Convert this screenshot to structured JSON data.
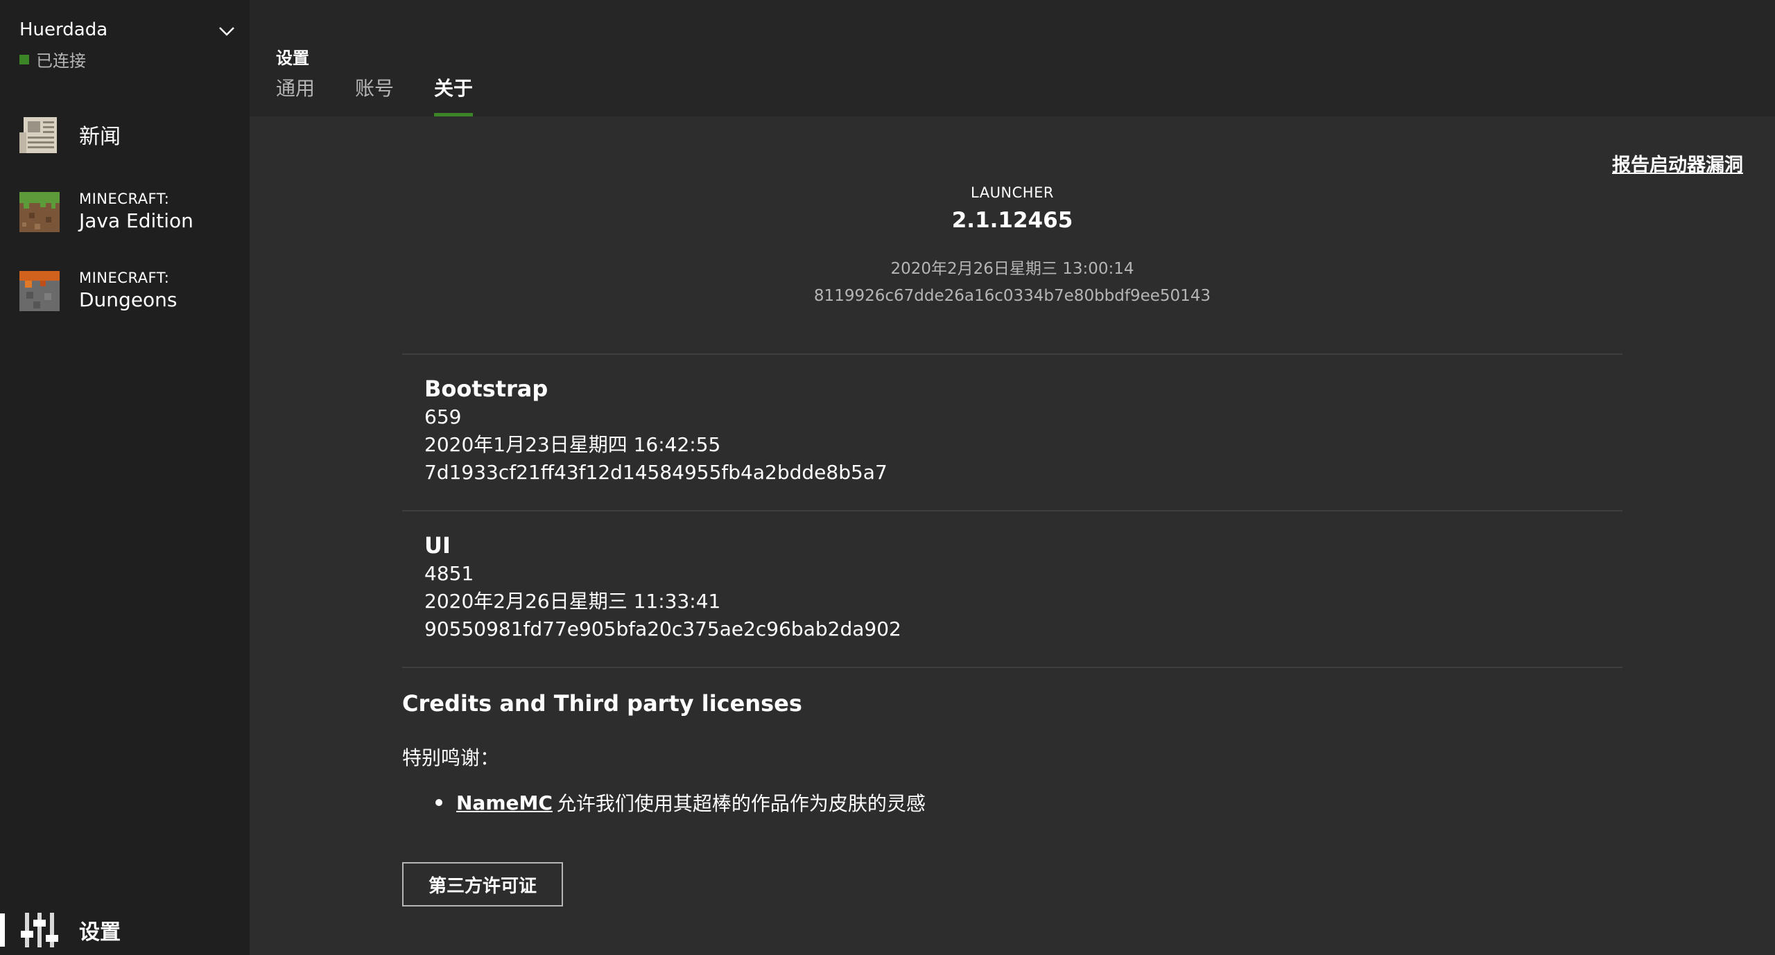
{
  "account": {
    "name": "Huerdada",
    "status": "已连接",
    "status_color": "#3c8527"
  },
  "sidebar": {
    "news": {
      "label": "新闻",
      "icon": "newspaper-icon"
    },
    "java": {
      "label_small": "MINECRAFT:",
      "label": "Java Edition",
      "icon": "grass-block-icon"
    },
    "dungeons": {
      "label_small": "MINECRAFT:",
      "label": "Dungeons",
      "icon": "dungeons-block-icon"
    },
    "settings": {
      "label": "设置",
      "icon": "sliders-icon"
    }
  },
  "header": {
    "title": "设置",
    "tabs": [
      {
        "label": "通用",
        "active": false
      },
      {
        "label": "账号",
        "active": false
      },
      {
        "label": "关于",
        "active": true
      }
    ],
    "accent": "#3c8527"
  },
  "main": {
    "report_link": "报告启动器漏洞",
    "launcher": {
      "label": "LAUNCHER",
      "version": "2.1.12465",
      "date": "2020年2月26日星期三 13:00:14",
      "hash": "8119926c67dde26a16c0334b7e80bbdf9ee50143"
    },
    "bootstrap": {
      "name": "Bootstrap",
      "build": "659",
      "date": "2020年1月23日星期四 16:42:55",
      "hash": "7d1933cf21ff43f12d14584955fb4a2bdde8b5a7"
    },
    "ui": {
      "name": "UI",
      "build": "4851",
      "date": "2020年2月26日星期三 11:33:41",
      "hash": "90550981fd77e905bfa20c375ae2c96bab2da902"
    },
    "credits": {
      "title": "Credits and Third party licenses",
      "thanks": "特别鸣谢：",
      "items": [
        {
          "link": "NameMC",
          "text": "允许我们使用其超棒的作品作为皮肤的灵感"
        }
      ],
      "license_button": "第三方许可证"
    }
  }
}
